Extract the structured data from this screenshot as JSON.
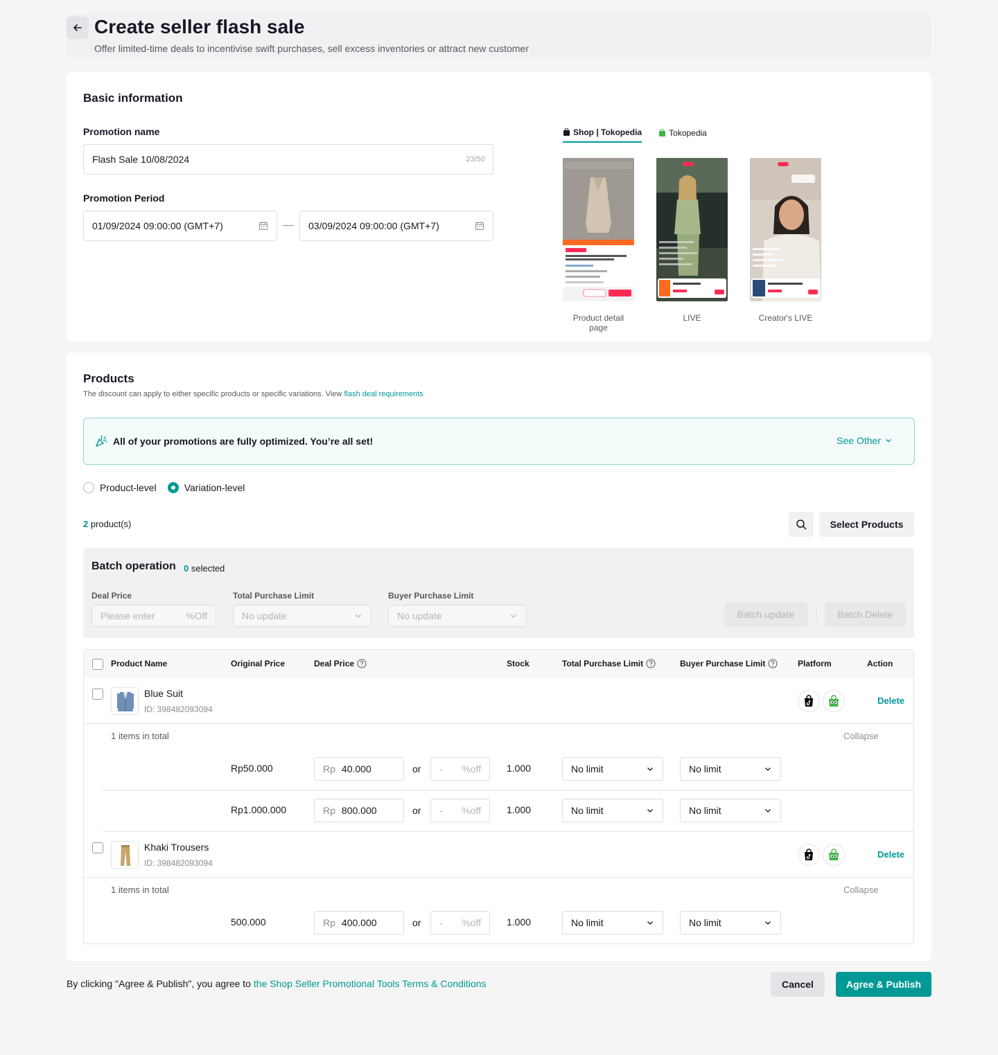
{
  "header": {
    "title": "Create seller flash sale",
    "subtitle": "Offer limited-time deals to incentivise swift purchases, sell excess inventories or attract new customer"
  },
  "basic": {
    "title": "Basic information",
    "promo_name_label": "Promotion name",
    "promo_name_value": "Flash Sale 10/08/2024",
    "promo_name_counter": "23/50",
    "period_label": "Promotion Period",
    "start": "01/09/2024 09:00:00 (GMT+7)",
    "end": "03/09/2024 09:00:00 (GMT+7)",
    "preview_tabs": [
      "Shop | Tokopedia",
      "Tokopedia"
    ],
    "previews": [
      "Product detail page",
      "LIVE",
      "Creator's LIVE"
    ]
  },
  "products": {
    "title": "Products",
    "desc": "The discount can apply to either specific products or specific variations. View ",
    "desc_link": "flash deal requirements",
    "banner": "All of your promotions are fully optimized. You’re all set!",
    "see_other": "See Other",
    "radio_product": "Product-level",
    "radio_variation": "Variation-level",
    "count": "2",
    "count_suffix": "product(s)",
    "select_btn": "Select Products"
  },
  "batch": {
    "title": "Batch operation",
    "selected_count": "0",
    "selected_suffix": "selected",
    "deal_label": "Deal Price",
    "deal_placeholder": "Please enter",
    "deal_suffix": "%Off",
    "total_label": "Total Purchase Limit",
    "total_value": "No update",
    "buyer_label": "Buyer Purchase Limit",
    "buyer_value": "No update",
    "update_btn": "Batch update",
    "delete_btn": "Batch Delete"
  },
  "table": {
    "headers": [
      "Product Name",
      "Original Price",
      "Deal Price",
      "Stock",
      "Total Purchase Limit",
      "Buyer Purchase Limit",
      "Platform",
      "Action"
    ],
    "delete": "Delete",
    "collapse": "Collapse",
    "or": "or",
    "rp": "Rp",
    "pct_dash": "-",
    "pct_suffix": "%off",
    "products": [
      {
        "name": "Blue Suit",
        "id": "ID: 398482093094",
        "total_text": "1 items in total",
        "variations": [
          {
            "orig": "Rp50.000",
            "deal": "40.000",
            "stock": "1.000",
            "total_limit": "No limit",
            "buyer_limit": "No limit"
          },
          {
            "orig": "Rp1.000.000",
            "deal": "800.000",
            "stock": "1.000",
            "total_limit": "No limit",
            "buyer_limit": "No limit"
          }
        ]
      },
      {
        "name": "Khaki Trousers",
        "id": "ID: 398482093094",
        "total_text": "1 items in total",
        "variations": [
          {
            "orig": "500.000",
            "deal": "400.000",
            "stock": "1.000",
            "total_limit": "No limit",
            "buyer_limit": "No limit"
          }
        ]
      }
    ]
  },
  "footer": {
    "text": "By clicking \"Agree & Publish\", you agree to ",
    "link": "the Shop Seller Promotional Tools Terms & Conditions",
    "cancel": "Cancel",
    "publish": "Agree & Publish"
  },
  "colors": {
    "accent": "#009995",
    "flash": "#fe6a1f",
    "tiktok": "#000000",
    "tokopedia": "#42b549"
  }
}
